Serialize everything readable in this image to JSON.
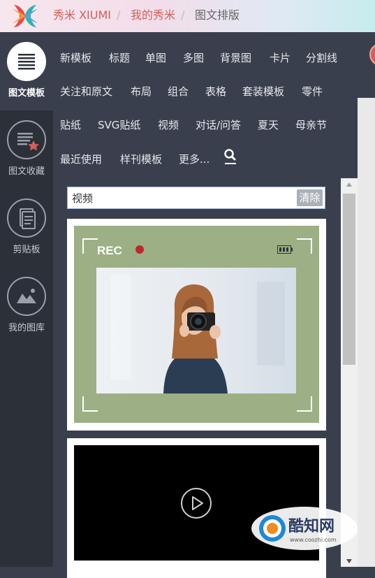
{
  "header": {
    "brand": "秀米 XIUMI",
    "sep1": "/",
    "crumb_my": "我的秀米",
    "sep2": "/",
    "crumb_current": "图文排版"
  },
  "left_nav": [
    {
      "label": "图文模板",
      "icon": "template-list-icon",
      "active": true
    },
    {
      "label": "图文收藏",
      "icon": "favorites-icon",
      "active": false
    },
    {
      "label": "剪贴板",
      "icon": "clipboard-icon",
      "active": false
    },
    {
      "label": "我的图库",
      "icon": "image-library-icon",
      "active": false
    }
  ],
  "categories": {
    "row1": [
      "新模板",
      "标题",
      "单图",
      "多图",
      "背景图",
      "卡片",
      "分割线"
    ],
    "row2": [
      "关注和原文",
      "布局",
      "组合",
      "表格",
      "套装模板",
      "零件"
    ],
    "row3": [
      "贴纸",
      "SVG贴纸",
      "视频",
      "对话/问答",
      "夏天",
      "母亲节"
    ],
    "row4": [
      "最近使用",
      "样刊模板",
      "更多..."
    ]
  },
  "search": {
    "value": "视频",
    "clear_label": "清除"
  },
  "templates": {
    "rec_label": "REC"
  },
  "watermark": {
    "brand": "酷知网",
    "url": "www.coozhi.com"
  },
  "colors": {
    "accent_red": "#d1605a",
    "sidebar_bg": "#2c3039",
    "panel_bg": "#3a3f4d",
    "template_green": "#9daf84"
  }
}
